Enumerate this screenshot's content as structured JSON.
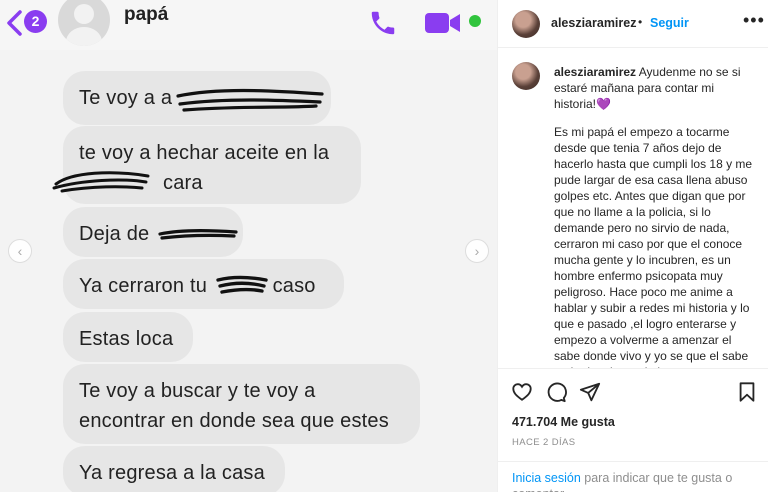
{
  "chat": {
    "badge_count": "2",
    "contact_name": "papá",
    "messages": [
      "Te voy a a",
      "te voy a hechar aceite en la",
      "cara",
      "Deja de",
      "Ya cerraron tu",
      "caso",
      "Estas loca",
      "Te voy a buscar y te voy a",
      "encontrar en donde sea que estes",
      "Ya regresa a la casa"
    ]
  },
  "post": {
    "username": "alesziaramirez",
    "separator": "•",
    "follow_label": "Seguir",
    "caption_username": "alesziaramirez",
    "caption_first": "Ayudenme no se si estaré mañana para contar mi historia!💜",
    "caption_body": "Es mi papá el empezo a tocarme desde que tenia 7 años dejo de hacerlo hasta que cumpli los 18 y me pude largar de esa casa llena abuso golpes etc. Antes que digan que por que no llame a la policia, si lo demande pero no sirvio de nada, cerraron mi caso por que el conoce mucha gente y lo incubren, es un hombre enfermo psicopata muy peligroso. Hace poco me anime a hablar y subir a redes mi historia y lo que e pasado ,el logro enterarse y empezo a volverme a amenzar el sabe donde vivo y yo se que el sabe cada de mis movimientos y temo por",
    "likes": "471.704 Me gusta",
    "time_ago": "HACE 2 DÍAS",
    "login_link": "Inicia sesión",
    "login_rest": " para indicar que te gusta o comentar."
  },
  "colors": {
    "accent_purple": "#8a3df0",
    "online_green": "#31c43d",
    "instagram_blue": "#0095f6"
  },
  "icons": [
    "chevron-left-icon",
    "phone-icon",
    "video-camera-icon",
    "heart-icon",
    "comment-icon",
    "share-icon",
    "bookmark-icon",
    "more-icon",
    "carousel-prev-icon",
    "carousel-next-icon"
  ]
}
